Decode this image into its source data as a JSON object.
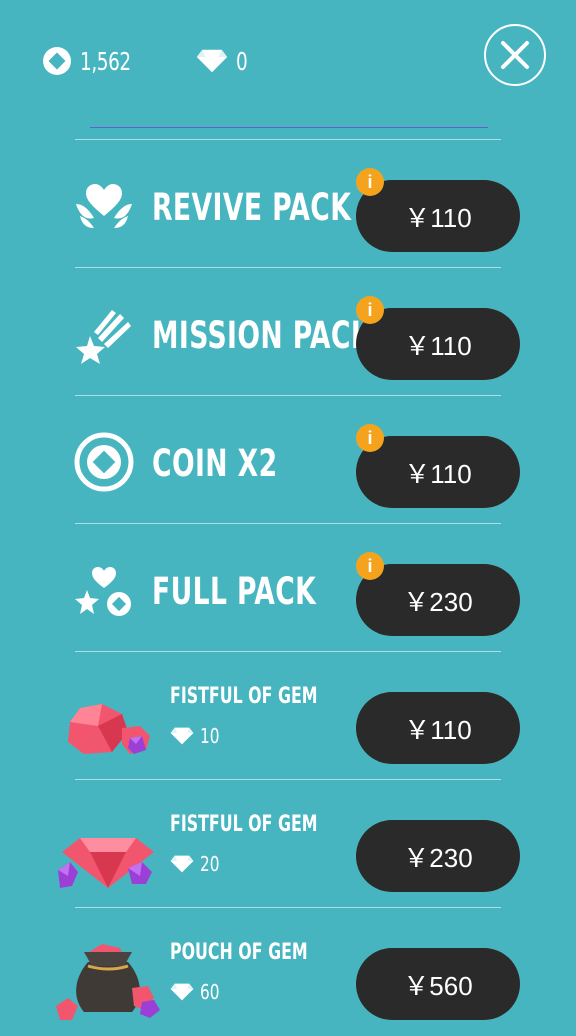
{
  "header": {
    "coins": "1,562",
    "gems": "0",
    "icons": {
      "coin": "coin-icon",
      "gem": "diamond-icon",
      "close": "close-icon"
    }
  },
  "packs": [
    {
      "name": "REVIVE PACK",
      "price": "￥110",
      "icon": "heart-wings-icon",
      "info": "i"
    },
    {
      "name": "MISSION PACK",
      "price": "￥110",
      "icon": "shooting-star-icon",
      "info": "i"
    },
    {
      "name": "COIN X2",
      "price": "￥110",
      "icon": "coin-icon",
      "info": "i"
    },
    {
      "name": "FULL PACK",
      "price": "￥230",
      "icon": "heart-star-coin-icon",
      "info": "i"
    }
  ],
  "gem_packs": [
    {
      "title": "FISTFUL OF GEM",
      "amount": "10",
      "price": "￥110",
      "icon": "gem-pile-icon"
    },
    {
      "title": "FISTFUL OF GEM",
      "amount": "20",
      "price": "￥230",
      "icon": "gem-cluster-icon"
    },
    {
      "title": "POUCH OF GEM",
      "amount": "60",
      "price": "￥560",
      "icon": "gem-pouch-icon"
    }
  ],
  "colors": {
    "background": "#47b5c0",
    "button": "#2a2a2a",
    "info_badge": "#f5a31c",
    "gem_pink": "#f2566e",
    "gem_purple": "#9b3fd6"
  }
}
